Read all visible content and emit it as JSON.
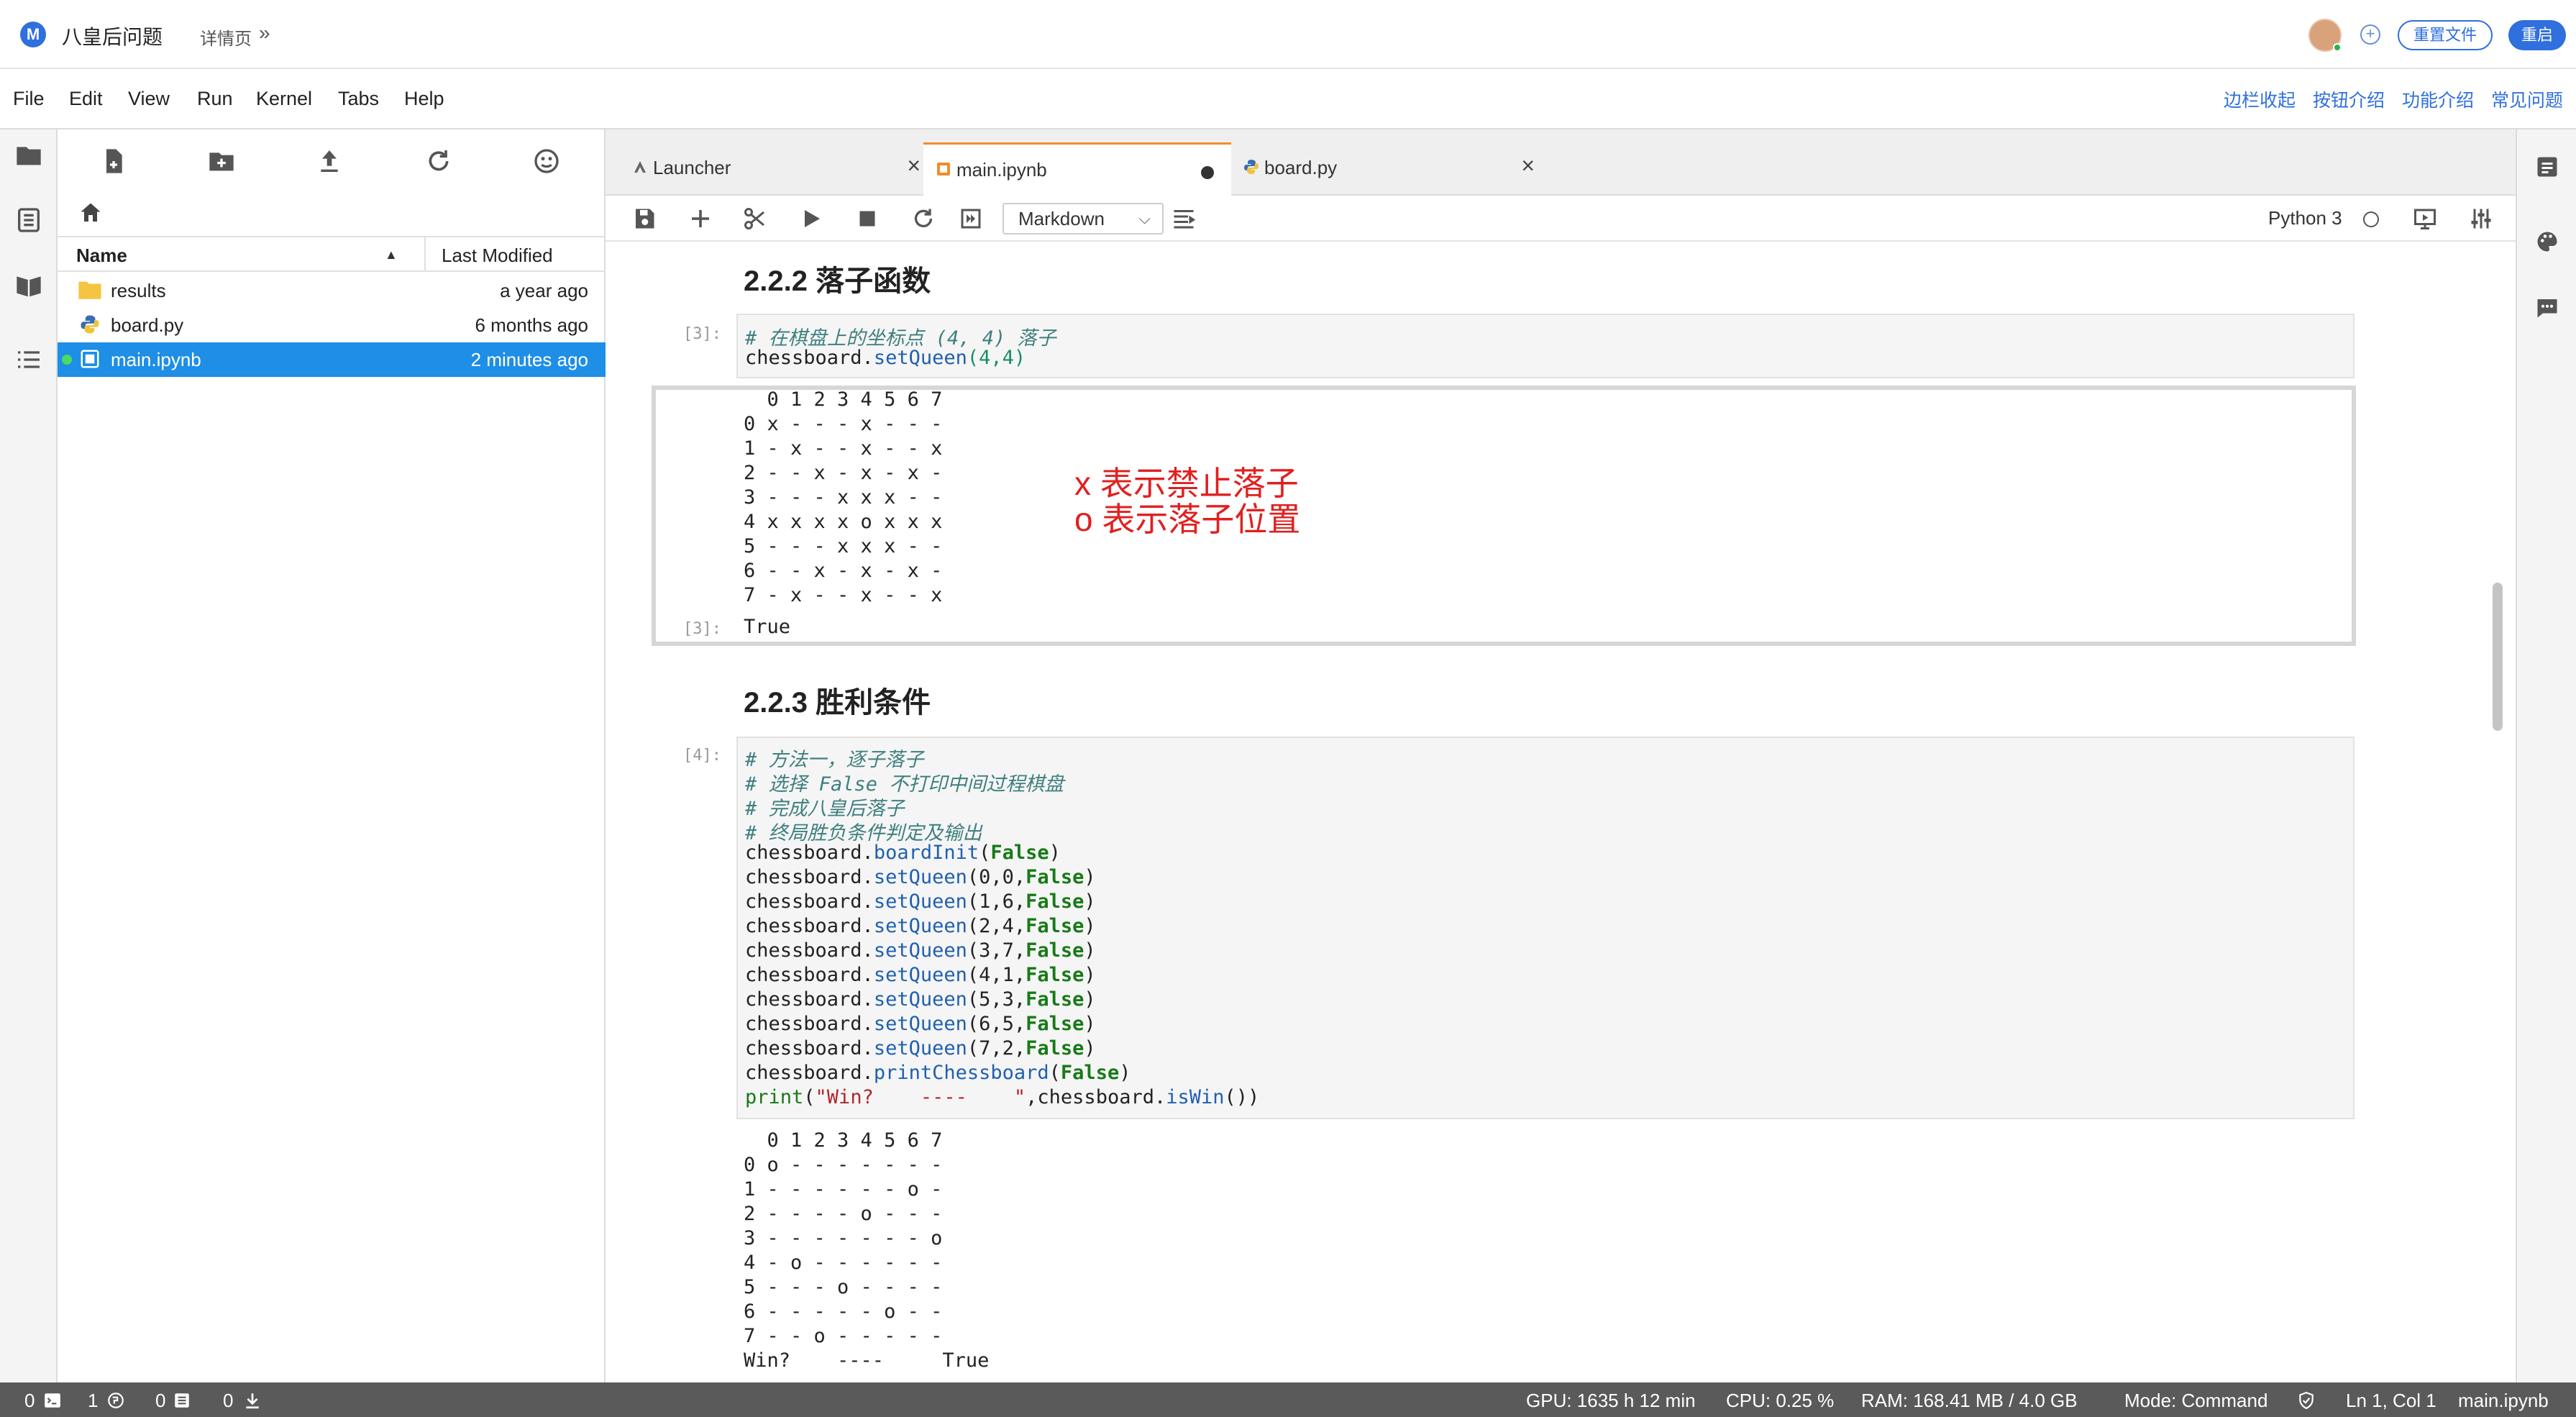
{
  "header": {
    "logo_letter": "M",
    "title": "八皇后问题",
    "detail_link": "详情页",
    "detail_chevron": "»",
    "reset_button": "重置文件",
    "restart_button": "重启",
    "add_icon": "plus-circle-icon"
  },
  "menu": {
    "items": [
      "File",
      "Edit",
      "View",
      "Run",
      "Kernel",
      "Tabs",
      "Help"
    ],
    "right_links": [
      "边栏收起",
      "按钮介绍",
      "功能介绍",
      "常见问题"
    ]
  },
  "activity_icons": [
    "folder-icon",
    "running-icon",
    "book-icon",
    "list-icon"
  ],
  "file_browser": {
    "toolbar_icons": [
      "new-file-icon",
      "new-folder-icon",
      "upload-icon",
      "refresh-icon",
      "git-icon"
    ],
    "columns": {
      "name": "Name",
      "modified": "Last Modified"
    },
    "files": [
      {
        "name": "results",
        "modified": "a year ago",
        "type": "folder"
      },
      {
        "name": "board.py",
        "modified": "6 months ago",
        "type": "python"
      },
      {
        "name": "main.ipynb",
        "modified": "2 minutes ago",
        "type": "notebook",
        "selected": true
      }
    ]
  },
  "tabs": [
    {
      "label": "Launcher",
      "active": false,
      "dirty": false
    },
    {
      "label": "main.ipynb",
      "active": true,
      "dirty": true
    },
    {
      "label": "board.py",
      "active": false,
      "dirty": false
    }
  ],
  "toolbar": {
    "cell_type": "Markdown",
    "kernel": "Python 3"
  },
  "notebook": {
    "section1": "2.2.2 落子函数",
    "cell3": {
      "prompt": "[3]:",
      "comment": "# 在棋盘上的坐标点 (4, 4) 落子",
      "code_obj": "chessboard.",
      "code_func": "setQueen",
      "code_args": "(4,4)"
    },
    "out3": {
      "board": [
        "  0 1 2 3 4 5 6 7",
        "0 x - - - x - - -",
        "1 - x - - x - - x",
        "2 - - x - x - x -",
        "3 - - - x x x - -",
        "4 x x x x o x x x",
        "5 - - - x x x - -",
        "6 - - x - x - x -",
        "7 - x - - x - - x"
      ],
      "prompt": "[3]:",
      "result": "True"
    },
    "annotation": [
      "x 表示禁止落子",
      "o 表示落子位置"
    ],
    "section2": "2.2.3 胜利条件",
    "cell4": {
      "prompt": "[4]:",
      "comments": [
        "# 方法一，逐子落子",
        "# 选择 False 不打印中间过程棋盘",
        "# 完成八皇后落子",
        "# 终局胜负条件判定及输出"
      ],
      "init": {
        "obj": "chessboard.",
        "func": "boardInit",
        "arg": "False"
      },
      "moves": [
        {
          "args": "(0,0,",
          "flag": "False"
        },
        {
          "args": "(1,6,",
          "flag": "False"
        },
        {
          "args": "(2,4,",
          "flag": "False"
        },
        {
          "args": "(3,7,",
          "flag": "False"
        },
        {
          "args": "(4,1,",
          "flag": "False"
        },
        {
          "args": "(5,3,",
          "flag": "False"
        },
        {
          "args": "(6,5,",
          "flag": "False"
        },
        {
          "args": "(7,2,",
          "flag": "False"
        }
      ],
      "move_func": "setQueen",
      "print_board": {
        "obj": "chessboard.",
        "func": "printChessboard",
        "arg": "False"
      },
      "print_stmt": {
        "fn": "print",
        "str": "\"Win?    ----    \"",
        "rest": ",chessboard.",
        "func": "isWin",
        "tail": "())"
      }
    },
    "out4": {
      "board": [
        "  0 1 2 3 4 5 6 7",
        "0 o - - - - - - -",
        "1 - - - - - - o -",
        "2 - - - - o - - -",
        "3 - - - - - - - o",
        "4 - o - - - - - -",
        "5 - - - o - - - -",
        "6 - - - - - o - -",
        "7 - - o - - - - -"
      ],
      "result": "Win?    ----     True"
    }
  },
  "status": {
    "terminals": "0",
    "kernels": "1",
    "tasks": "0",
    "downloads": "0",
    "gpu": "GPU: 1635 h 12 min",
    "cpu": "CPU: 0.25 %",
    "ram": "RAM: 168.41 MB / 4.0 GB",
    "mode": "Mode: Command",
    "position": "Ln 1, Col 1",
    "file": "main.ipynb"
  },
  "colors": {
    "accent": "#2f6fde",
    "selection": "#1e8ee6",
    "annotation": "#e02020",
    "statusbar": "#5a5a5a"
  }
}
